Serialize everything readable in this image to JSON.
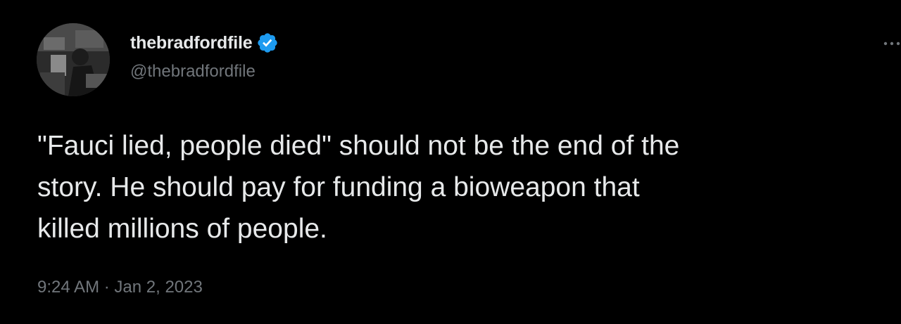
{
  "user": {
    "display_name": "thebradfordfile",
    "handle": "@thebradfordfile",
    "verified": true
  },
  "tweet": {
    "text": "\"Fauci lied, people died\" should not be the end of the\nstory. He should pay for funding a bioweapon that\nkilled millions of people.",
    "time": "9:24 AM",
    "separator": " · ",
    "date": "Jan 2, 2023"
  },
  "icons": {
    "verified": "verified-badge-icon",
    "more": "more-options-icon"
  },
  "colors": {
    "background": "#000000",
    "primary_text": "#e7e9ea",
    "secondary_text": "#71767b",
    "verified_blue": "#1d9bf0"
  }
}
